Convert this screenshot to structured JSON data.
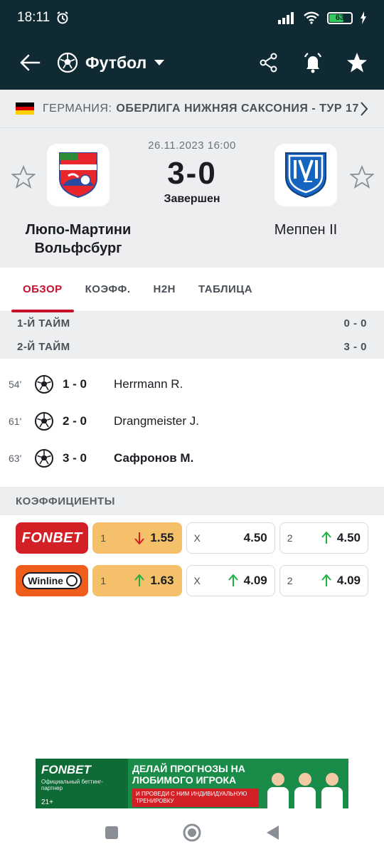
{
  "status_bar": {
    "time": "18:11",
    "battery": "63"
  },
  "header": {
    "sport": "Футбол"
  },
  "league": {
    "country": "ГЕРМАНИЯ:",
    "name": "ОБЕРЛИГА НИЖНЯЯ САКСОНИЯ - ТУР 17"
  },
  "match": {
    "datetime": "26.11.2023 16:00",
    "score": "3-0",
    "status": "Завершен",
    "home": {
      "name": "Люпо-Мартини Вольфсбург"
    },
    "away": {
      "name": "Меппен II"
    }
  },
  "tabs": [
    {
      "label": "ОБЗОР"
    },
    {
      "label": "КОЭФФ."
    },
    {
      "label": "H2H"
    },
    {
      "label": "ТАБЛИЦА"
    }
  ],
  "halves": [
    {
      "label": "1-Й ТАЙМ",
      "score": "0 - 0"
    },
    {
      "label": "2-Й ТАЙМ",
      "score": "3 - 0"
    }
  ],
  "events": [
    {
      "minute": "54'",
      "score": "1 - 0",
      "player": "Herrmann R."
    },
    {
      "minute": "61'",
      "score": "2 - 0",
      "player": "Drangmeister J."
    },
    {
      "minute": "63'",
      "score": "3 - 0",
      "player": "Сафронов М."
    }
  ],
  "odds": {
    "title": "КОЭФФИЦИЕНТЫ",
    "rows": [
      {
        "bookmaker": "FONBET",
        "cells": [
          {
            "label": "1",
            "value": "1.55",
            "trend": "down"
          },
          {
            "label": "X",
            "value": "4.50",
            "trend": "none"
          },
          {
            "label": "2",
            "value": "4.50",
            "trend": "up"
          }
        ]
      },
      {
        "bookmaker": "Winline",
        "cells": [
          {
            "label": "1",
            "value": "1.63",
            "trend": "up"
          },
          {
            "label": "X",
            "value": "4.09",
            "trend": "up"
          },
          {
            "label": "2",
            "value": "4.09",
            "trend": "up"
          }
        ]
      }
    ]
  },
  "ad": {
    "brand": "FONBET",
    "brand_sub": "Официальный беттинг-партнер",
    "age": "21+",
    "headline": "ДЕЛАЙ ПРОГНОЗЫ НА ЛЮБИМОГО ИГРОКА",
    "cta": "И ПРОВЕДИ С НИМ ИНДИВИДУАЛЬНУЮ ТРЕНИРОВКУ"
  },
  "colors": {
    "header_bg": "#0f2a33",
    "accent": "#c8102e",
    "up": "#1fb141",
    "down": "#d31f26",
    "highlight": "#f5c06a"
  }
}
